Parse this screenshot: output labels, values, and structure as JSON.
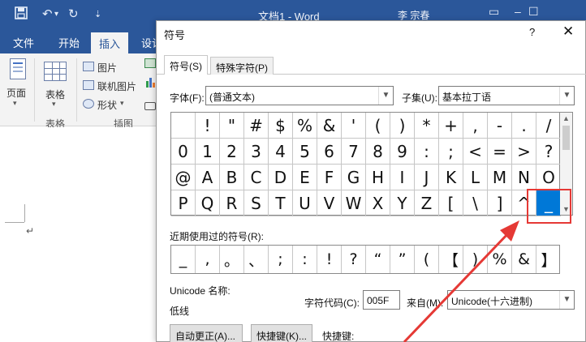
{
  "word": {
    "doc_title": "文档1 - Word",
    "user": "李 宗春",
    "tabs": [
      {
        "label": "文件"
      },
      {
        "label": "开始"
      },
      {
        "label": "插入"
      },
      {
        "label": "设计"
      }
    ],
    "ribbon": {
      "page_label": "页面",
      "table_label": "表格",
      "tables_group": "表格",
      "picture": "图片",
      "online_picture": "联机图片",
      "shapes": "形状",
      "illustrations_group": "插图"
    }
  },
  "dialog": {
    "title": "符号",
    "help": "?",
    "close": "✕",
    "tabs": [
      {
        "label": "符号(S)"
      },
      {
        "label": "特殊字符(P)"
      }
    ],
    "font_label": "字体(F):",
    "font_value": "(普通文本)",
    "subset_label": "子集(U):",
    "subset_value": "基本拉丁语",
    "symbols": [
      " ",
      "!",
      "\"",
      "#",
      "$",
      "%",
      "&",
      "'",
      "(",
      ")",
      "*",
      "+",
      ",",
      "-",
      ".",
      "/",
      "0",
      "1",
      "2",
      "3",
      "4",
      "5",
      "6",
      "7",
      "8",
      "9",
      ":",
      ";",
      "<",
      "=",
      ">",
      "?",
      "@",
      "A",
      "B",
      "C",
      "D",
      "E",
      "F",
      "G",
      "H",
      "I",
      "J",
      "K",
      "L",
      "M",
      "N",
      "O",
      "P",
      "Q",
      "R",
      "S",
      "T",
      "U",
      "V",
      "W",
      "X",
      "Y",
      "Z",
      "[",
      "\\",
      "]",
      "^",
      "_"
    ],
    "selected_symbol": "_",
    "recent_label": "近期使用过的符号(R):",
    "recent": [
      "_",
      ",",
      "。",
      "、",
      ";",
      ":",
      "!",
      "?",
      "“",
      "”",
      "(",
      "【",
      ")",
      "%",
      "&",
      "】"
    ],
    "unicode_name_label": "Unicode 名称:",
    "unicode_name_value": "低线",
    "char_code_label": "字符代码(C):",
    "char_code_value": "005F",
    "from_label": "来自(M):",
    "from_value": "Unicode(十六进制)",
    "autocorrect_button": "自动更正(A)...",
    "shortcut_button": "快捷键(K)...",
    "shortcut_label": "快捷键:"
  },
  "colors": {
    "word_blue": "#2b579a",
    "selection": "#0078d7",
    "annotation": "#e53935"
  }
}
